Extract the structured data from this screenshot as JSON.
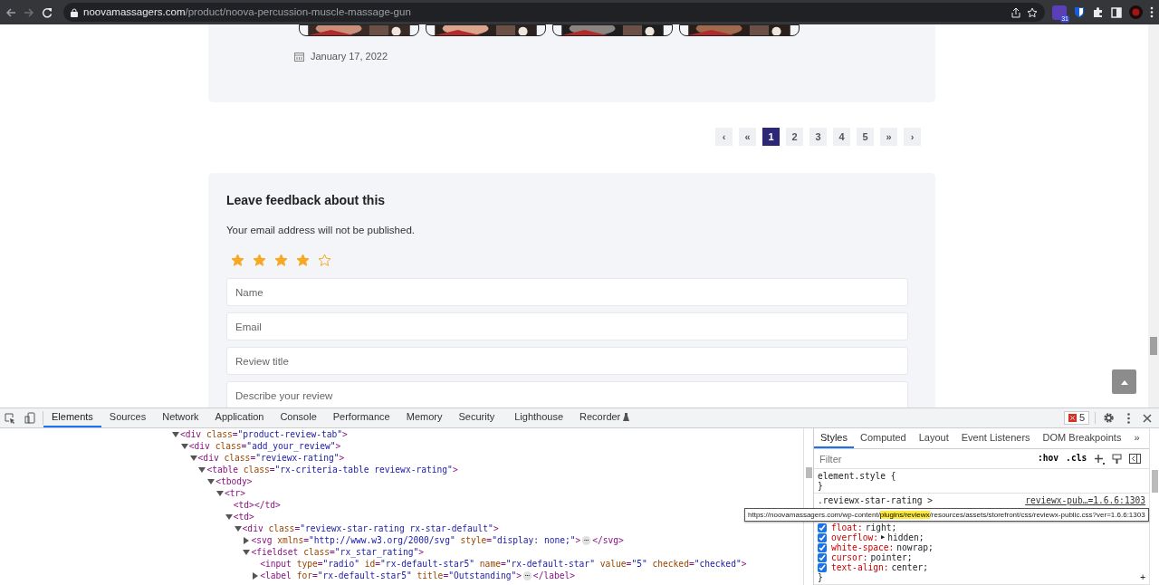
{
  "browser": {
    "url_domain": "noovamassagers.com",
    "url_path": "/product/noova-percussion-muscle-massage-gun",
    "extension_badge": "31"
  },
  "date": "January 17, 2022",
  "pagination": [
    {
      "label": "‹",
      "selected": false
    },
    {
      "label": "«",
      "selected": false
    },
    {
      "label": "1",
      "selected": true
    },
    {
      "label": "2",
      "selected": false
    },
    {
      "label": "3",
      "selected": false
    },
    {
      "label": "4",
      "selected": false
    },
    {
      "label": "5",
      "selected": false
    },
    {
      "label": "»",
      "selected": false
    },
    {
      "label": "›",
      "selected": false
    }
  ],
  "feedback": {
    "title": "Leave feedback about this",
    "note": "Your email address will not be published.",
    "stars": 4,
    "fields": [
      {
        "placeholder": "Name"
      },
      {
        "placeholder": "Email"
      },
      {
        "placeholder": "Review title"
      },
      {
        "placeholder": "Describe your review"
      }
    ]
  },
  "devtools": {
    "tabs": [
      {
        "label": "Elements",
        "selected": true
      },
      {
        "label": "Sources",
        "selected": false
      },
      {
        "label": "Network",
        "selected": false
      },
      {
        "label": "Application",
        "selected": false
      },
      {
        "label": "Console",
        "selected": false
      },
      {
        "label": "Performance",
        "selected": false
      },
      {
        "label": "Memory",
        "selected": false
      },
      {
        "label": "Security",
        "selected": false
      },
      {
        "label": "Lighthouse",
        "selected": false
      },
      {
        "label": "Recorder",
        "selected": false
      }
    ],
    "error_count": "5",
    "elements": [
      {
        "kind": "parent",
        "expanded": true,
        "tag": "<div class=\"product-review-tab\">",
        "children": [
          {
            "kind": "parent",
            "expanded": true,
            "tag": "<div class=\"add_your_review\">",
            "children": [
              {
                "kind": "parent",
                "expanded": true,
                "tag": "<div class=\"reviewx-rating\">",
                "children": [
                  {
                    "kind": "parent",
                    "expanded": true,
                    "tag": "<table class=\"rx-criteria-table reviewx-rating\">",
                    "children": [
                      {
                        "kind": "parent",
                        "expanded": true,
                        "tag": "<tbody>",
                        "children": [
                          {
                            "kind": "parent",
                            "expanded": true,
                            "tag": "<tr>",
                            "children": [
                              {
                                "kind": "leaf",
                                "tag": "<td></td>"
                              },
                              {
                                "kind": "parent",
                                "expanded": true,
                                "tag": "<td>",
                                "children": [
                                  {
                                    "kind": "parent",
                                    "expanded": true,
                                    "tag": "<div class=\"reviewx-star-rating rx-star-default\">",
                                    "children": [
                                      {
                                        "kind": "parent",
                                        "expanded": false,
                                        "tag": "<svg xmlns=\"http://www.w3.org/2000/svg\" style=\"display: none;\">",
                                        "ellipsis": "⋯",
                                        "close": "</svg>"
                                      },
                                      {
                                        "kind": "parent",
                                        "expanded": true,
                                        "tag": "<fieldset class=\"rx_star_rating\">",
                                        "children": [
                                          {
                                            "kind": "leaf",
                                            "tag": "<input type=\"radio\" id=\"rx-default-star5\" name=\"rx-default-star\" value=\"5\" checked=\"checked\">"
                                          },
                                          {
                                            "kind": "parent",
                                            "expanded": false,
                                            "tag": "<label for=\"rx-default-star5\" title=\"Outstanding\">",
                                            "ellipsis": "⋯",
                                            "close": "</label>"
                                          }
                                        ]
                                      }
                                    ]
                                  }
                                ]
                              }
                            ]
                          }
                        ]
                      }
                    ]
                  }
                ]
              }
            ]
          }
        ]
      }
    ],
    "styles": {
      "tabs": [
        {
          "label": "Styles",
          "selected": true
        },
        {
          "label": "Computed",
          "selected": false
        },
        {
          "label": "Layout",
          "selected": false
        },
        {
          "label": "Event Listeners",
          "selected": false
        },
        {
          "label": "DOM Breakpoints",
          "selected": false
        }
      ],
      "more": "»",
      "filter_placeholder": "Filter",
      "hov": ":hov",
      "cls": ".cls",
      "rules": [
        {
          "selector": "element.style {",
          "close": "}"
        },
        {
          "selector": ".reviewx-star-rating >",
          "source": "reviewx-pub…=1.6.6:1303",
          "properties": [
            {
              "name": "float:",
              "value": "right;",
              "checked": true
            },
            {
              "name": "overflow:",
              "toggle": "▶",
              "value": "hidden;",
              "checked": true
            },
            {
              "name": "white-space:",
              "value": "nowrap;",
              "checked": true
            },
            {
              "name": "cursor:",
              "value": "pointer;",
              "checked": true
            },
            {
              "name": "text-align:",
              "value": "center;",
              "checked": true
            }
          ],
          "close": "}"
        }
      ],
      "add": "+",
      "tooltip": {
        "before": "https://noovamassagers.com/wp-content/",
        "highlight": "plugins/reviewx",
        "after": "/resources/assets/storefront/css/reviewx-public.css?ver=1.6.6:1303"
      }
    }
  }
}
